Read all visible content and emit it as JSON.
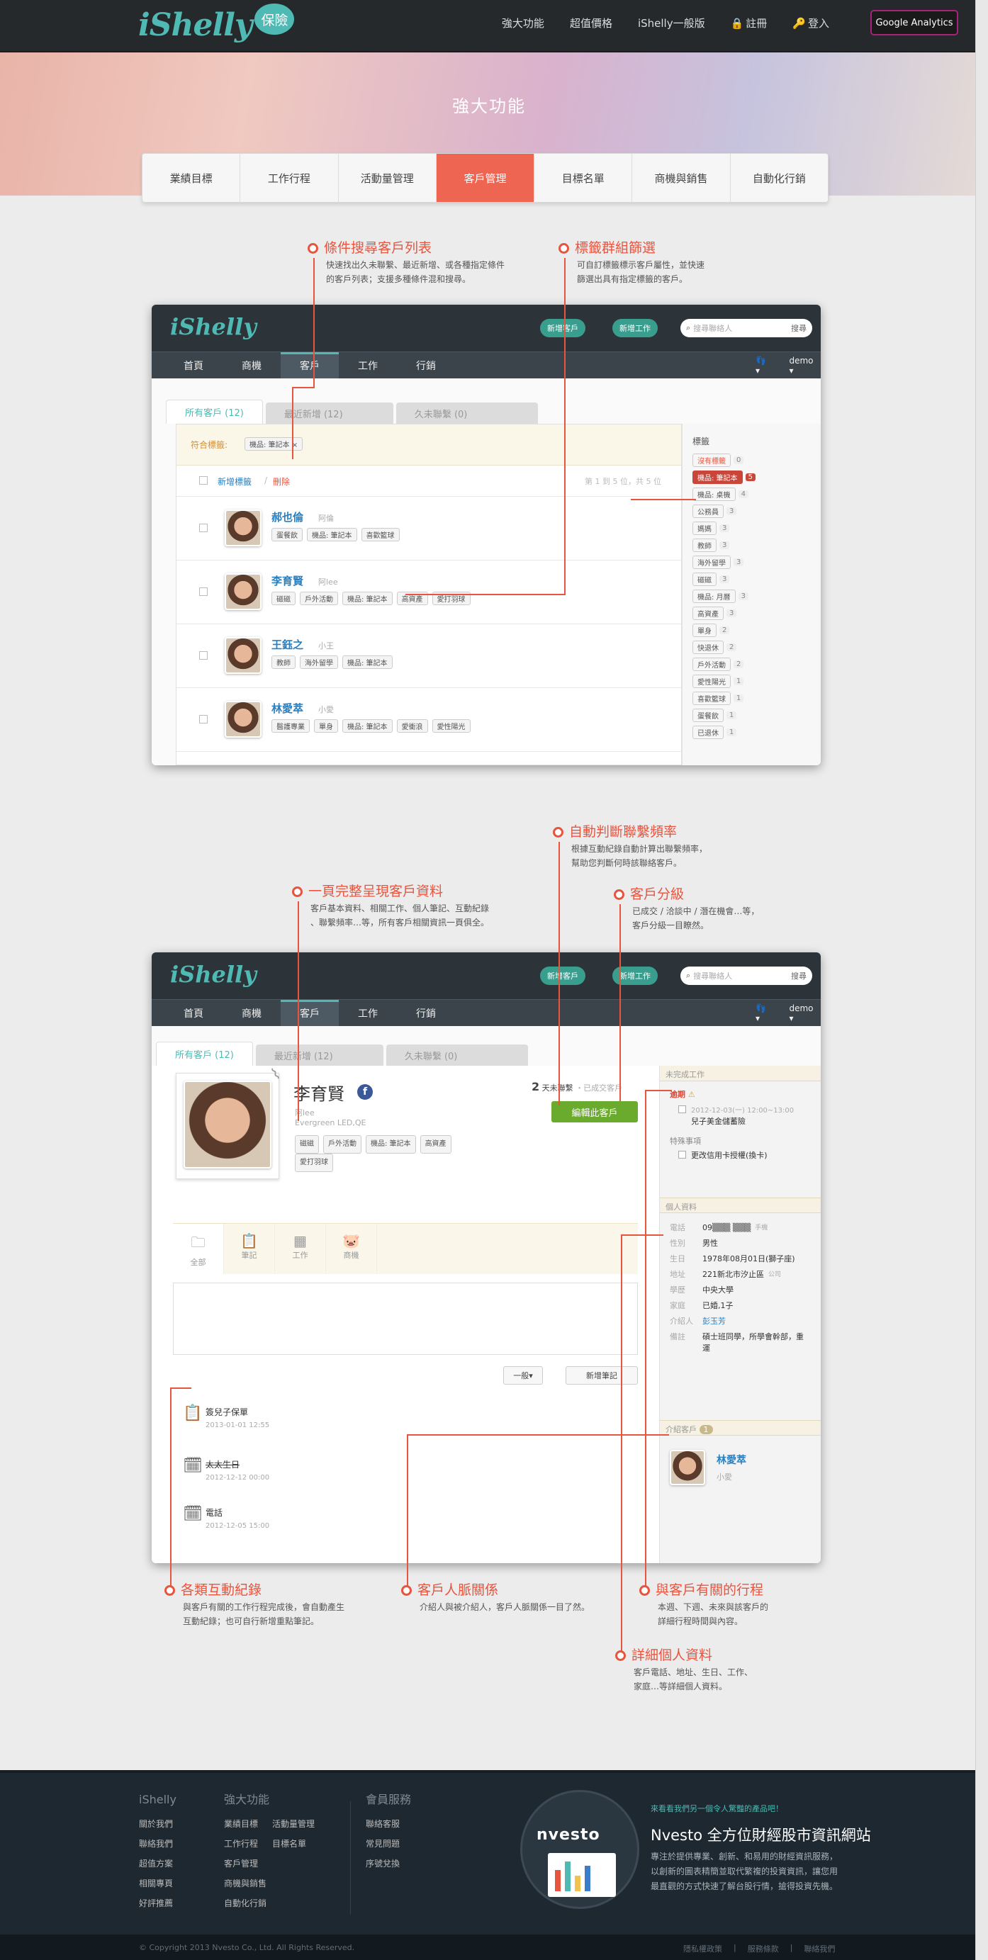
{
  "header": {
    "logo_text": "iShelly",
    "logo_badge": "保險",
    "nav": [
      "強大功能",
      "超值價格",
      "iShelly一般版",
      "註冊",
      "登入"
    ],
    "ga_button": "Google Analytics"
  },
  "hero": {
    "title": "強大功能"
  },
  "feature_tabs": [
    "業績目標",
    "工作行程",
    "活動量管理",
    "客戶管理",
    "目標名單",
    "商機與銷售",
    "自動化行銷"
  ],
  "section1": {
    "callouts": [
      {
        "title": "條件搜尋客戶列表",
        "text1": "快速找出久未聯繫、最近新增、或各種指定條件",
        "text2": "的客戶列表；支援多種條件混和搜尋。"
      },
      {
        "title": "標籤群組篩選",
        "text1": "可自訂標籤標示客戶屬性，並快速",
        "text2": "篩選出具有指定標籤的客戶。"
      }
    ],
    "app": {
      "logo": "iShelly",
      "new_customer": "新增客戶",
      "new_task": "新增工作",
      "search_placeholder": "搜尋聯絡人",
      "search_btn": "搜尋",
      "nav": [
        "首頁",
        "商機",
        "客戶",
        "工作",
        "行銷"
      ],
      "user": "demo",
      "subtabs": [
        "所有客戶 (12)",
        "最近新增 (12)",
        "久未聯繫 (0)"
      ],
      "filter_label": "符合標籤:",
      "filter_tag": "機品: 筆記本",
      "add_tag": "新增標籤",
      "delete": "刪除",
      "pager": "第 1 到 5 位，共 5 位",
      "rows": [
        {
          "name": "郝也倫",
          "nick": "阿倫",
          "tags": [
            "蛋餐飲",
            "機品: 筆記本",
            "喜歡籃球"
          ]
        },
        {
          "name": "李育賢",
          "nick": "阿lee",
          "tags": [
            "磁磁",
            "戶外活動",
            "機品: 筆記本",
            "高資產",
            "愛打羽球"
          ]
        },
        {
          "name": "王鈺之",
          "nick": "小王",
          "tags": [
            "教師",
            "海外留學",
            "機品: 筆記本"
          ]
        },
        {
          "name": "林愛萃",
          "nick": "小愛",
          "tags": [
            "醫護專業",
            "單身",
            "機品: 筆記本",
            "愛衝浪",
            "愛性陽光"
          ]
        }
      ],
      "side_title": "標籤",
      "side_tags": [
        {
          "t": "沒有標籤",
          "n": "0"
        },
        {
          "t": "機品: 筆記本",
          "n": "5"
        },
        {
          "t": "機品: 桌機",
          "n": "4"
        },
        {
          "t": "公務員",
          "n": "3"
        },
        {
          "t": "媽媽",
          "n": "3"
        },
        {
          "t": "教師",
          "n": "3"
        },
        {
          "t": "海外留學",
          "n": "3"
        },
        {
          "t": "磁磁",
          "n": "3"
        },
        {
          "t": "機品: 月曆",
          "n": "3"
        },
        {
          "t": "高資產",
          "n": "3"
        },
        {
          "t": "單身",
          "n": "2"
        },
        {
          "t": "快退休",
          "n": "2"
        },
        {
          "t": "戶外活動",
          "n": "2"
        },
        {
          "t": "愛性陽光",
          "n": "1"
        },
        {
          "t": "喜歡籃球",
          "n": "1"
        },
        {
          "t": "蛋餐飲",
          "n": "1"
        },
        {
          "t": "已退休",
          "n": "1"
        }
      ]
    }
  },
  "section2": {
    "callouts": [
      {
        "title": "自動判斷聯繫頻率",
        "text1": "根據互動紀錄自動計算出聯繫頻率，",
        "text2": "幫助您判斷何時該聯絡客戶。"
      },
      {
        "title": "一頁完整呈現客戶資料",
        "text1": "客戶基本資料、相關工作、個人筆記、互動紀錄",
        "text2": "、聯繫頻率…等，所有客戶相關資訊一頁俱全。"
      },
      {
        "title": "客戶分級",
        "text1": "已成交 / 洽談中 / 潛在機會…等，",
        "text2": "客戶分級一目瞭然。"
      },
      {
        "title": "各類互動紀錄",
        "text1": "與客戶有關的工作行程完成後，會自動產生",
        "text2": "互動紀錄；也可自行新增重點筆記。"
      },
      {
        "title": "客戶人脈關係",
        "text1": "介紹人與被介紹人，客戶人脈關係一目了然。",
        "text2": ""
      },
      {
        "title": "與客戶有關的行程",
        "text1": "本週、下週、未來與該客戶的",
        "text2": "詳細行程時間與內容。"
      },
      {
        "title": "詳細個人資料",
        "text1": "客戶電話、地址、生日、工作、",
        "text2": "家庭…等詳細個人資料。"
      }
    ],
    "app": {
      "profile_name": "李育賢",
      "nick": "阿lee",
      "company": "Evergreen LED,QE",
      "tags": [
        "磁磁",
        "戶外活動",
        "機品: 筆記本",
        "高資產",
        "愛打羽球"
      ],
      "freq_num": "2",
      "freq_text": "天未聯繫",
      "status": "・已成交客戶",
      "edit_btn": "編輯此客戶",
      "icon_tabs": [
        "全部",
        "筆記",
        "工作",
        "商機"
      ],
      "select_label": "一般",
      "add_note_btn": "新增筆記",
      "timeline": [
        {
          "title": "簽兒子保單",
          "time": "2013-01-01 12:55"
        },
        {
          "title": "太太生日",
          "time": "2012-12-12 00:00"
        },
        {
          "title": "電話",
          "time": "2012-12-05 15:00"
        }
      ],
      "pending_title": "未完成工作",
      "overdue_label": "逾期",
      "overdue_date": "2012-12-03(一) 12:00~13:00",
      "overdue_task": "兒子美金儲蓄險",
      "special_label": "特殊事項",
      "special_task": "更改信用卡授權(換卡)",
      "personal_title": "個人資料",
      "personal": [
        {
          "k": "電話",
          "v": "09▒▒▒ ▒▒▒",
          "x": "手機"
        },
        {
          "k": "性別",
          "v": "男性",
          "x": ""
        },
        {
          "k": "生日",
          "v": "1978年08月01日(獅子座)",
          "x": ""
        },
        {
          "k": "地址",
          "v": "221新北市汐止區",
          "x": "公司"
        },
        {
          "k": "學歷",
          "v": "中央大學",
          "x": ""
        },
        {
          "k": "家庭",
          "v": "已婚,1子",
          "x": ""
        },
        {
          "k": "介紹人",
          "v": "彭玉芳",
          "x": ""
        },
        {
          "k": "備註",
          "v": "碩士班同學，所學會幹部，重 運",
          "x": ""
        }
      ],
      "referral_title": "介紹客戶",
      "referral_count": "1",
      "referral_name": "林愛萃",
      "referral_nick": "小愛"
    }
  },
  "footer": {
    "col1": {
      "title": "iShelly",
      "items": [
        "關於我們",
        "聯絡我們",
        "超值方案",
        "相關專頁",
        "好評推薦"
      ]
    },
    "col2": {
      "title": "強大功能",
      "items": [
        "業績目標",
        "活動量管理",
        "工作行程",
        "目標名單",
        "客戶管理",
        "商機與銷售",
        "自動化行銷"
      ]
    },
    "col3": {
      "title": "會員服務",
      "items": [
        "聯絡客服",
        "常見問題",
        "序號兌換"
      ]
    },
    "promo_small": "來看看我們另一個令人驚豔的產品吧！",
    "promo_brand": "nvesto",
    "promo_title": "Nvesto 全方位財經股市資訊網站",
    "promo_text": [
      "專注於提供專業、創新、和易用的財經資訊服務，",
      "以創新的圖表精簡並取代繁複的投資資訊，讓您用",
      "最直觀的方式快速了解台股行情，搶得投資先機。"
    ],
    "copyright": "© Copyright 2013 Nvesto Co., Ltd. All Rights Reserved.",
    "links": [
      "隱私權政策",
      "服務條款",
      "聯絡我們"
    ]
  }
}
